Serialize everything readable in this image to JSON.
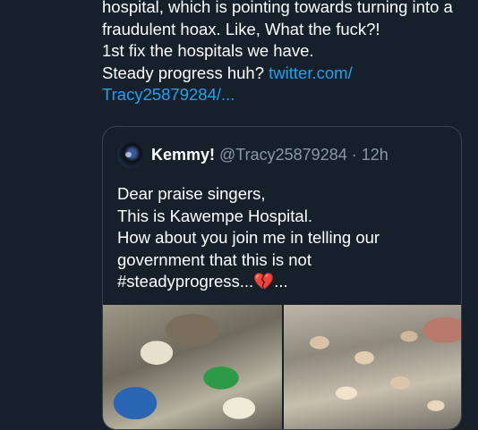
{
  "tweet": {
    "lines": [
      "hospital, which is pointing towards turning into a",
      "fraudulent hoax. Like, What the fuck?!",
      "1st fix the hospitals we have.",
      "Steady progress huh? "
    ],
    "link_part1": "twitter.com/",
    "link_part2": "Tracy25879284/..."
  },
  "quoted": {
    "display_name": "Kemmy!",
    "handle": "@Tracy25879284",
    "separator": "·",
    "time": "12h",
    "lines": [
      "Dear praise singers,",
      "This is Kawempe Hospital.",
      "How about you join me in telling our",
      "government that this is not",
      "#steadyprogress..."
    ],
    "emoji": "💔",
    "trailing": "..."
  },
  "colors": {
    "background": "#15202b",
    "link": "#1da1f2",
    "secondary_text": "#8899a6",
    "border": "#38444d"
  }
}
